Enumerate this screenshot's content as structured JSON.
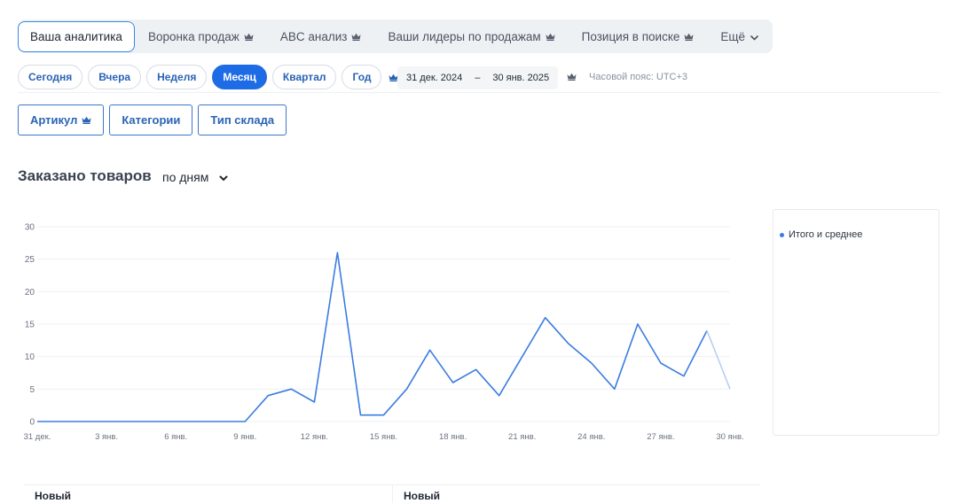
{
  "tabs": [
    {
      "label": "Ваша аналитика",
      "active": true,
      "premium": false
    },
    {
      "label": "Воронка продаж",
      "active": false,
      "premium": true
    },
    {
      "label": "ABC анализ",
      "active": false,
      "premium": true
    },
    {
      "label": "Ваши лидеры по продажам",
      "active": false,
      "premium": true
    },
    {
      "label": "Позиция в поиске",
      "active": false,
      "premium": true
    },
    {
      "label": "Ещё",
      "active": false,
      "premium": false
    }
  ],
  "periods": [
    {
      "label": "Сегодня",
      "active": false
    },
    {
      "label": "Вчера",
      "active": false
    },
    {
      "label": "Неделя",
      "active": false
    },
    {
      "label": "Месяц",
      "active": true
    },
    {
      "label": "Квартал",
      "active": false
    },
    {
      "label": "Год",
      "active": false
    }
  ],
  "date_range": {
    "from": "31 дек. 2024",
    "separator": "–",
    "to": "30 янв. 2025"
  },
  "timezone": "Часовой пояс: UTC+3",
  "filters": [
    {
      "label": "Артикул",
      "premium": true
    },
    {
      "label": "Категории",
      "premium": false
    },
    {
      "label": "Тип склада",
      "premium": false
    }
  ],
  "chart_heading": {
    "title": "Заказано товаров",
    "granularity": "по дням"
  },
  "colors": {
    "accent": "#1e6be6",
    "line": "#3a7de0",
    "line_partial": "#b9cff2",
    "premium": "#5a6270"
  },
  "icons": {
    "premium": "crown-icon",
    "dropdown": "chevron-down-icon"
  },
  "legend": {
    "label": "Итого и среднее"
  },
  "table": {
    "headers": [
      "Новый",
      "Новый"
    ]
  },
  "chart_data": {
    "type": "line",
    "title": "Заказано товаров",
    "xlabel": "",
    "ylabel": "",
    "ylim": [
      0,
      30
    ],
    "yticks": [
      0,
      5,
      10,
      15,
      20,
      25,
      30
    ],
    "grid": true,
    "legend_position": "right",
    "x_tick_labels": [
      "31 дек.",
      "3 янв.",
      "6 янв.",
      "9 янв.",
      "12 янв.",
      "15 янв.",
      "18 янв.",
      "21 янв.",
      "24 янв.",
      "27 янв.",
      "30 янв."
    ],
    "x": [
      "31 дек.",
      "1 янв.",
      "2 янв.",
      "3 янв.",
      "4 янв.",
      "5 янв.",
      "6 янв.",
      "7 янв.",
      "8 янв.",
      "9 янв.",
      "10 янв.",
      "11 янв.",
      "12 янв.",
      "13 янв.",
      "14 янв.",
      "15 янв.",
      "16 янв.",
      "17 янв.",
      "18 янв.",
      "19 янв.",
      "20 янв.",
      "21 янв.",
      "22 янв.",
      "23 янв.",
      "24 янв.",
      "25 янв.",
      "26 янв.",
      "27 янв.",
      "28 янв.",
      "29 янв.",
      "30 янв."
    ],
    "series": [
      {
        "name": "Итого и среднее",
        "values": [
          0,
          0,
          0,
          0,
          0,
          0,
          0,
          0,
          0,
          0,
          4,
          5,
          3,
          26,
          1,
          1,
          5,
          11,
          6,
          8,
          4,
          10,
          16,
          12,
          9,
          5,
          15,
          9,
          7,
          14,
          5
        ]
      }
    ]
  }
}
